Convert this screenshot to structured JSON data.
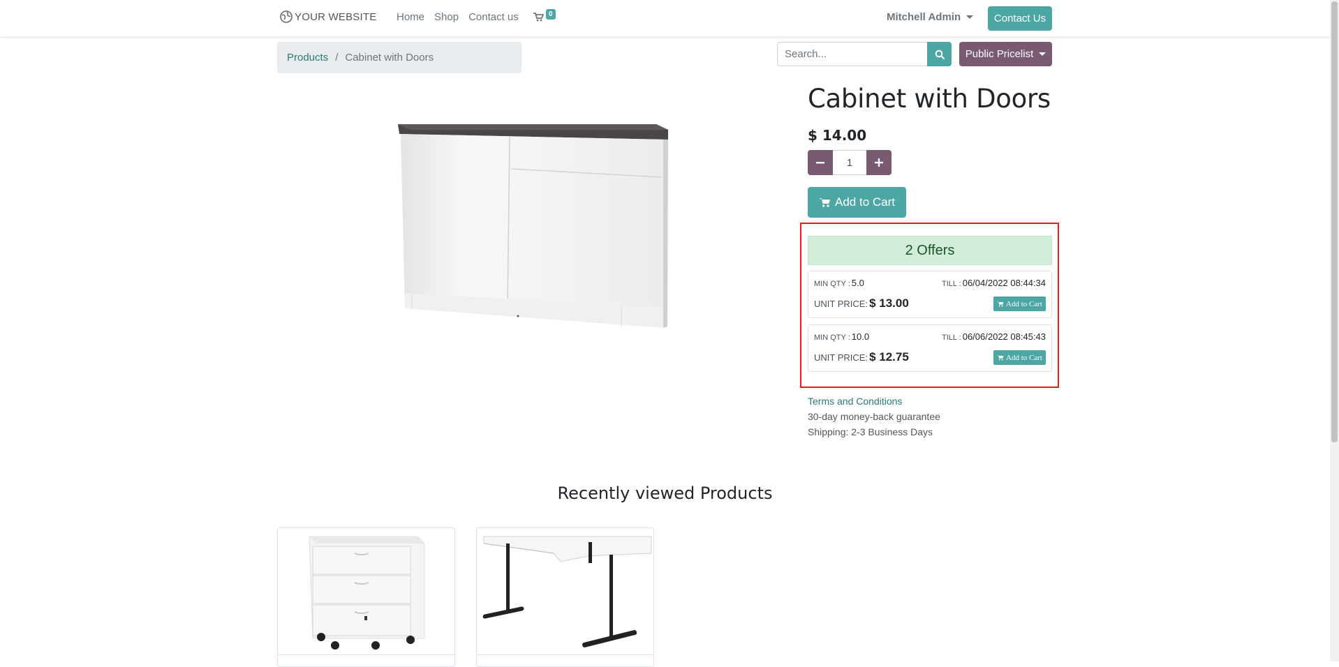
{
  "header": {
    "brand": "YOUR WEBSITE",
    "nav": [
      "Home",
      "Shop",
      "Contact us"
    ],
    "cart_count": "0",
    "user": "Mitchell Admin",
    "contact_button": "Contact Us"
  },
  "breadcrumb": {
    "parent": "Products",
    "separator": "/",
    "current": "Cabinet with Doors"
  },
  "search": {
    "placeholder": "Search..."
  },
  "pricelist": {
    "label": "Public Pricelist"
  },
  "product": {
    "name": "Cabinet with Doors",
    "price": "$ 14.00",
    "quantity": "1",
    "add_to_cart": "Add to Cart"
  },
  "offers": {
    "header": "2 Offers",
    "min_qty_label": "MIN QTY :",
    "till_label": "TILL :",
    "unit_price_label": "UNIT PRICE:",
    "add_label": "Add to Cart",
    "items": [
      {
        "min_qty": "5.0",
        "till": "06/04/2022 08:44:34",
        "unit_price": "$ 13.00"
      },
      {
        "min_qty": "10.0",
        "till": "06/06/2022 08:45:43",
        "unit_price": "$ 12.75"
      }
    ]
  },
  "info": {
    "terms": "Terms and Conditions",
    "guarantee": "30-day money-back guarantee",
    "shipping": "Shipping: 2-3 Business Days"
  },
  "recent": {
    "title": "Recently viewed Products"
  },
  "colors": {
    "primary": "#4ca6a4",
    "secondary": "#7a5a73",
    "highlight": "#e02020",
    "success_bg": "#d4edda"
  }
}
